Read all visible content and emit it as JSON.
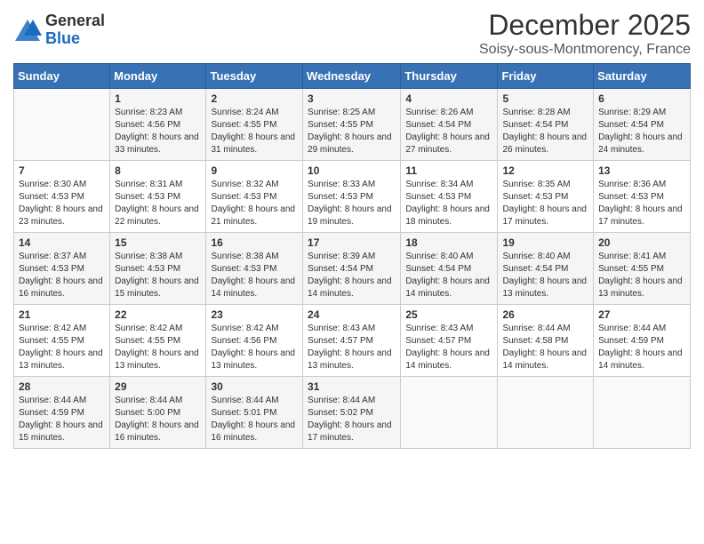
{
  "header": {
    "logo_general": "General",
    "logo_blue": "Blue",
    "month_title": "December 2025",
    "location": "Soisy-sous-Montmorency, France"
  },
  "days_of_week": [
    "Sunday",
    "Monday",
    "Tuesday",
    "Wednesday",
    "Thursday",
    "Friday",
    "Saturday"
  ],
  "weeks": [
    [
      {
        "day": "",
        "sunrise": "",
        "sunset": "",
        "daylight": ""
      },
      {
        "day": "1",
        "sunrise": "Sunrise: 8:23 AM",
        "sunset": "Sunset: 4:56 PM",
        "daylight": "Daylight: 8 hours and 33 minutes."
      },
      {
        "day": "2",
        "sunrise": "Sunrise: 8:24 AM",
        "sunset": "Sunset: 4:55 PM",
        "daylight": "Daylight: 8 hours and 31 minutes."
      },
      {
        "day": "3",
        "sunrise": "Sunrise: 8:25 AM",
        "sunset": "Sunset: 4:55 PM",
        "daylight": "Daylight: 8 hours and 29 minutes."
      },
      {
        "day": "4",
        "sunrise": "Sunrise: 8:26 AM",
        "sunset": "Sunset: 4:54 PM",
        "daylight": "Daylight: 8 hours and 27 minutes."
      },
      {
        "day": "5",
        "sunrise": "Sunrise: 8:28 AM",
        "sunset": "Sunset: 4:54 PM",
        "daylight": "Daylight: 8 hours and 26 minutes."
      },
      {
        "day": "6",
        "sunrise": "Sunrise: 8:29 AM",
        "sunset": "Sunset: 4:54 PM",
        "daylight": "Daylight: 8 hours and 24 minutes."
      }
    ],
    [
      {
        "day": "7",
        "sunrise": "Sunrise: 8:30 AM",
        "sunset": "Sunset: 4:53 PM",
        "daylight": "Daylight: 8 hours and 23 minutes."
      },
      {
        "day": "8",
        "sunrise": "Sunrise: 8:31 AM",
        "sunset": "Sunset: 4:53 PM",
        "daylight": "Daylight: 8 hours and 22 minutes."
      },
      {
        "day": "9",
        "sunrise": "Sunrise: 8:32 AM",
        "sunset": "Sunset: 4:53 PM",
        "daylight": "Daylight: 8 hours and 21 minutes."
      },
      {
        "day": "10",
        "sunrise": "Sunrise: 8:33 AM",
        "sunset": "Sunset: 4:53 PM",
        "daylight": "Daylight: 8 hours and 19 minutes."
      },
      {
        "day": "11",
        "sunrise": "Sunrise: 8:34 AM",
        "sunset": "Sunset: 4:53 PM",
        "daylight": "Daylight: 8 hours and 18 minutes."
      },
      {
        "day": "12",
        "sunrise": "Sunrise: 8:35 AM",
        "sunset": "Sunset: 4:53 PM",
        "daylight": "Daylight: 8 hours and 17 minutes."
      },
      {
        "day": "13",
        "sunrise": "Sunrise: 8:36 AM",
        "sunset": "Sunset: 4:53 PM",
        "daylight": "Daylight: 8 hours and 17 minutes."
      }
    ],
    [
      {
        "day": "14",
        "sunrise": "Sunrise: 8:37 AM",
        "sunset": "Sunset: 4:53 PM",
        "daylight": "Daylight: 8 hours and 16 minutes."
      },
      {
        "day": "15",
        "sunrise": "Sunrise: 8:38 AM",
        "sunset": "Sunset: 4:53 PM",
        "daylight": "Daylight: 8 hours and 15 minutes."
      },
      {
        "day": "16",
        "sunrise": "Sunrise: 8:38 AM",
        "sunset": "Sunset: 4:53 PM",
        "daylight": "Daylight: 8 hours and 14 minutes."
      },
      {
        "day": "17",
        "sunrise": "Sunrise: 8:39 AM",
        "sunset": "Sunset: 4:54 PM",
        "daylight": "Daylight: 8 hours and 14 minutes."
      },
      {
        "day": "18",
        "sunrise": "Sunrise: 8:40 AM",
        "sunset": "Sunset: 4:54 PM",
        "daylight": "Daylight: 8 hours and 14 minutes."
      },
      {
        "day": "19",
        "sunrise": "Sunrise: 8:40 AM",
        "sunset": "Sunset: 4:54 PM",
        "daylight": "Daylight: 8 hours and 13 minutes."
      },
      {
        "day": "20",
        "sunrise": "Sunrise: 8:41 AM",
        "sunset": "Sunset: 4:55 PM",
        "daylight": "Daylight: 8 hours and 13 minutes."
      }
    ],
    [
      {
        "day": "21",
        "sunrise": "Sunrise: 8:42 AM",
        "sunset": "Sunset: 4:55 PM",
        "daylight": "Daylight: 8 hours and 13 minutes."
      },
      {
        "day": "22",
        "sunrise": "Sunrise: 8:42 AM",
        "sunset": "Sunset: 4:55 PM",
        "daylight": "Daylight: 8 hours and 13 minutes."
      },
      {
        "day": "23",
        "sunrise": "Sunrise: 8:42 AM",
        "sunset": "Sunset: 4:56 PM",
        "daylight": "Daylight: 8 hours and 13 minutes."
      },
      {
        "day": "24",
        "sunrise": "Sunrise: 8:43 AM",
        "sunset": "Sunset: 4:57 PM",
        "daylight": "Daylight: 8 hours and 13 minutes."
      },
      {
        "day": "25",
        "sunrise": "Sunrise: 8:43 AM",
        "sunset": "Sunset: 4:57 PM",
        "daylight": "Daylight: 8 hours and 14 minutes."
      },
      {
        "day": "26",
        "sunrise": "Sunrise: 8:44 AM",
        "sunset": "Sunset: 4:58 PM",
        "daylight": "Daylight: 8 hours and 14 minutes."
      },
      {
        "day": "27",
        "sunrise": "Sunrise: 8:44 AM",
        "sunset": "Sunset: 4:59 PM",
        "daylight": "Daylight: 8 hours and 14 minutes."
      }
    ],
    [
      {
        "day": "28",
        "sunrise": "Sunrise: 8:44 AM",
        "sunset": "Sunset: 4:59 PM",
        "daylight": "Daylight: 8 hours and 15 minutes."
      },
      {
        "day": "29",
        "sunrise": "Sunrise: 8:44 AM",
        "sunset": "Sunset: 5:00 PM",
        "daylight": "Daylight: 8 hours and 16 minutes."
      },
      {
        "day": "30",
        "sunrise": "Sunrise: 8:44 AM",
        "sunset": "Sunset: 5:01 PM",
        "daylight": "Daylight: 8 hours and 16 minutes."
      },
      {
        "day": "31",
        "sunrise": "Sunrise: 8:44 AM",
        "sunset": "Sunset: 5:02 PM",
        "daylight": "Daylight: 8 hours and 17 minutes."
      },
      {
        "day": "",
        "sunrise": "",
        "sunset": "",
        "daylight": ""
      },
      {
        "day": "",
        "sunrise": "",
        "sunset": "",
        "daylight": ""
      },
      {
        "day": "",
        "sunrise": "",
        "sunset": "",
        "daylight": ""
      }
    ]
  ]
}
